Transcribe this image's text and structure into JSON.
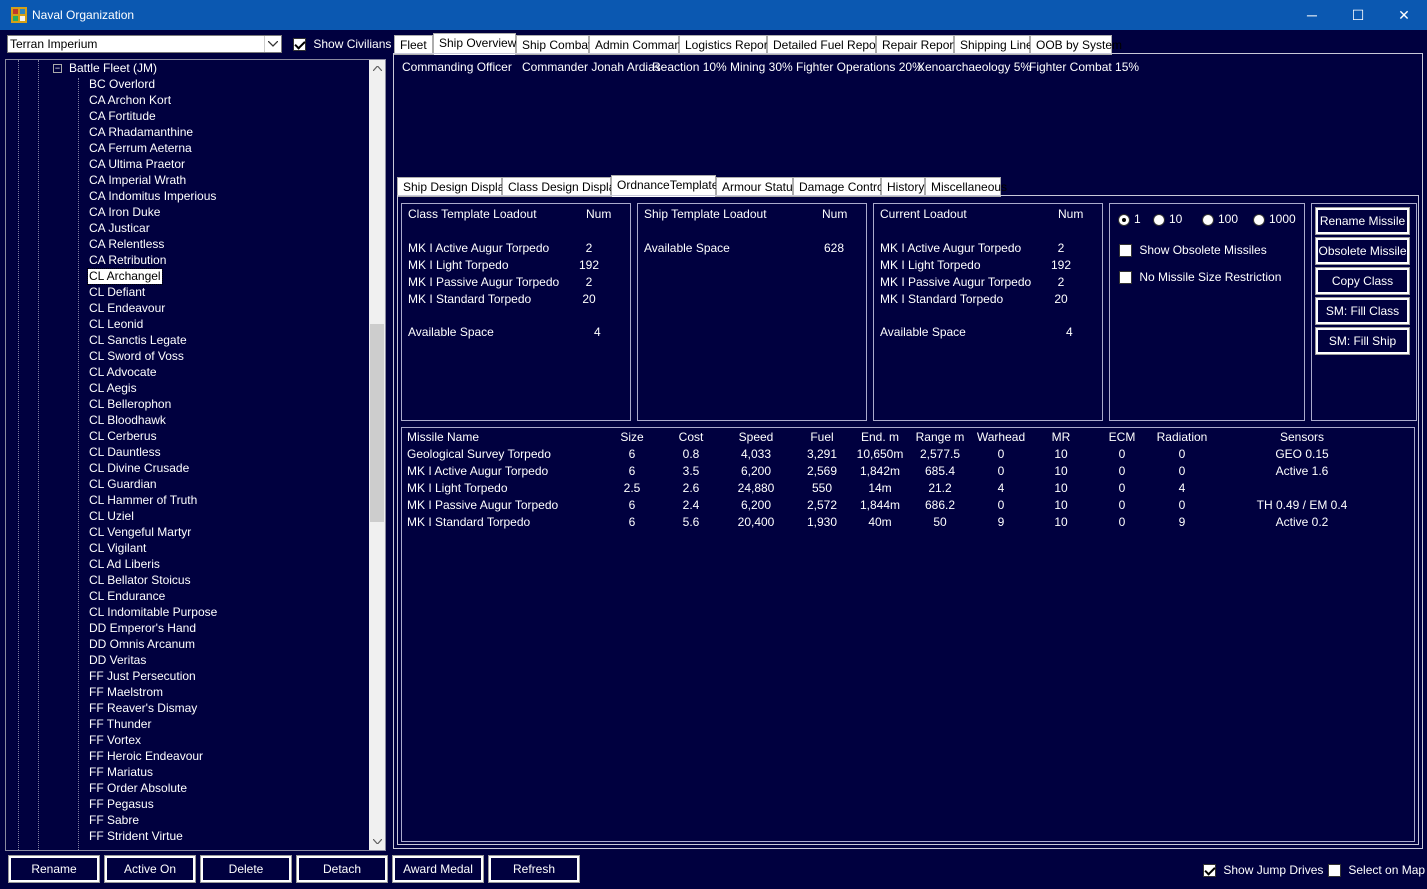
{
  "window": {
    "title": "Naval Organization",
    "minimize": "─",
    "maximize": "☐",
    "close": "✕"
  },
  "race_select": {
    "value": "Terran Imperium"
  },
  "show_civilians": {
    "label": "Show Civilians",
    "checked": true
  },
  "tree": {
    "root": {
      "label": "Battle Fleet  (JM)",
      "expander": "⊟"
    },
    "items": [
      "BC Overlord",
      "CA Archon Kort",
      "CA Fortitude",
      "CA Rhadamanthine",
      "CA Ferrum Aeterna",
      "CA Ultima Praetor",
      "CA Imperial Wrath",
      "CA Indomitus Imperious",
      "CA Iron Duke",
      "CA Justicar",
      "CA Relentless",
      "CA Retribution",
      "CL Archangel",
      "CL Defiant",
      "CL Endeavour",
      "CL Leonid",
      "CL Sanctis Legate",
      "CL Sword of Voss",
      "CL Advocate",
      "CL Aegis",
      "CL Bellerophon",
      "CL Bloodhawk",
      "CL Cerberus",
      "CL Dauntless",
      "CL Divine Crusade",
      "CL Guardian",
      "CL Hammer of Truth",
      "CL Uziel",
      "CL Vengeful Martyr",
      "CL Vigilant",
      "CL Ad Liberis",
      "CL Bellator Stoicus",
      "CL Endurance",
      "CL Indomitable Purpose",
      "DD Emperor's Hand",
      "DD Omnis Arcanum",
      "DD Veritas",
      "FF Just Persecution",
      "FF Maelstrom",
      "FF Reaver's Dismay",
      "FF Thunder",
      "FF Vortex",
      "FF Heroic Endeavour",
      "FF Mariatus",
      "FF Order Absolute",
      "FF Pegasus",
      "FF Sabre",
      "FF Strident Virtue"
    ],
    "selected_index": 12
  },
  "bottom_buttons": [
    "Rename",
    "Active On",
    "Delete",
    "Detach",
    "Award Medal",
    "Refresh"
  ],
  "bottom_checks": [
    {
      "label": "Show Jump Drives",
      "checked": true
    },
    {
      "label": "Select on Map",
      "checked": false
    }
  ],
  "main_tabs": [
    "Fleet",
    "Ship Overview",
    "Ship Combat",
    "Admin Command",
    "Logistics Report",
    "Detailed Fuel Report",
    "Repair Report",
    "Shipping Line",
    "OOB by System"
  ],
  "main_tab_active": 1,
  "officer": {
    "label": "Commanding Officer",
    "name": "Commander Jonah Ardias",
    "skills": [
      "Reaction 10%",
      "Mining 30%",
      "Fighter Operations 20%",
      "Xenoarchaeology 5%",
      "Fighter Combat 15%"
    ]
  },
  "sub_tabs": [
    "Ship Design Display",
    "Class Design Display",
    "OrdnanceTemplate",
    "Armour Status",
    "Damage Control",
    "History",
    "Miscellaneous"
  ],
  "sub_tab_active": 2,
  "class_template": {
    "title": "Class Template Loadout",
    "num_header": "Num",
    "rows": [
      {
        "name": "MK I Active Augur Torpedo",
        "num": "2"
      },
      {
        "name": "MK I Light Torpedo",
        "num": "192"
      },
      {
        "name": "MK I Passive Augur Torpedo",
        "num": "2"
      },
      {
        "name": "MK I Standard Torpedo",
        "num": "20"
      }
    ],
    "space_label": "Available Space",
    "space_value": "4"
  },
  "ship_template": {
    "title": "Ship Template Loadout",
    "num_header": "Num",
    "space_label": "Available Space",
    "space_value": "628"
  },
  "current_loadout": {
    "title": "Current Loadout",
    "num_header": "Num",
    "rows": [
      {
        "name": "MK I Active Augur Torpedo",
        "num": "2"
      },
      {
        "name": "MK I Light Torpedo",
        "num": "192"
      },
      {
        "name": "MK I Passive Augur Torpedo",
        "num": "2"
      },
      {
        "name": "MK I Standard Torpedo",
        "num": "20"
      }
    ],
    "space_label": "Available Space",
    "space_value": "4"
  },
  "quantity_options": [
    {
      "label": "1",
      "selected": true
    },
    {
      "label": "10",
      "selected": false
    },
    {
      "label": "100",
      "selected": false
    },
    {
      "label": "1000",
      "selected": false
    }
  ],
  "options": [
    {
      "label": "Show Obsolete Missiles",
      "checked": false
    },
    {
      "label": "No Missile Size Restriction",
      "checked": false
    }
  ],
  "side_buttons": [
    "Rename Missile",
    "Obsolete Missile",
    "Copy Class",
    "SM: Fill Class",
    "SM: Fill Ship"
  ],
  "missile_table": {
    "headers": [
      "Missile Name",
      "Size",
      "Cost",
      "Speed",
      "Fuel",
      "End. m",
      "Range m",
      "Warhead",
      "MR",
      "ECM",
      "Radiation",
      "Sensors"
    ],
    "rows": [
      [
        "Geological Survey Torpedo",
        "6",
        "0.8",
        "4,033",
        "3,291",
        "10,650m",
        "2,577.5",
        "0",
        "10",
        "0",
        "0",
        "GEO 0.15"
      ],
      [
        "MK I Active Augur Torpedo",
        "6",
        "3.5",
        "6,200",
        "2,569",
        "1,842m",
        "685.4",
        "0",
        "10",
        "0",
        "0",
        "Active 1.6"
      ],
      [
        "MK I Light Torpedo",
        "2.5",
        "2.6",
        "24,880",
        "550",
        "14m",
        "21.2",
        "4",
        "10",
        "0",
        "4",
        ""
      ],
      [
        "MK I Passive Augur Torpedo",
        "6",
        "2.4",
        "6,200",
        "2,572",
        "1,844m",
        "686.2",
        "0",
        "10",
        "0",
        "0",
        "TH 0.49 /  EM 0.4"
      ],
      [
        "MK I Standard Torpedo",
        "6",
        "5.6",
        "20,400",
        "1,930",
        "40m",
        "50",
        "9",
        "10",
        "0",
        "9",
        "Active 0.2"
      ]
    ]
  }
}
